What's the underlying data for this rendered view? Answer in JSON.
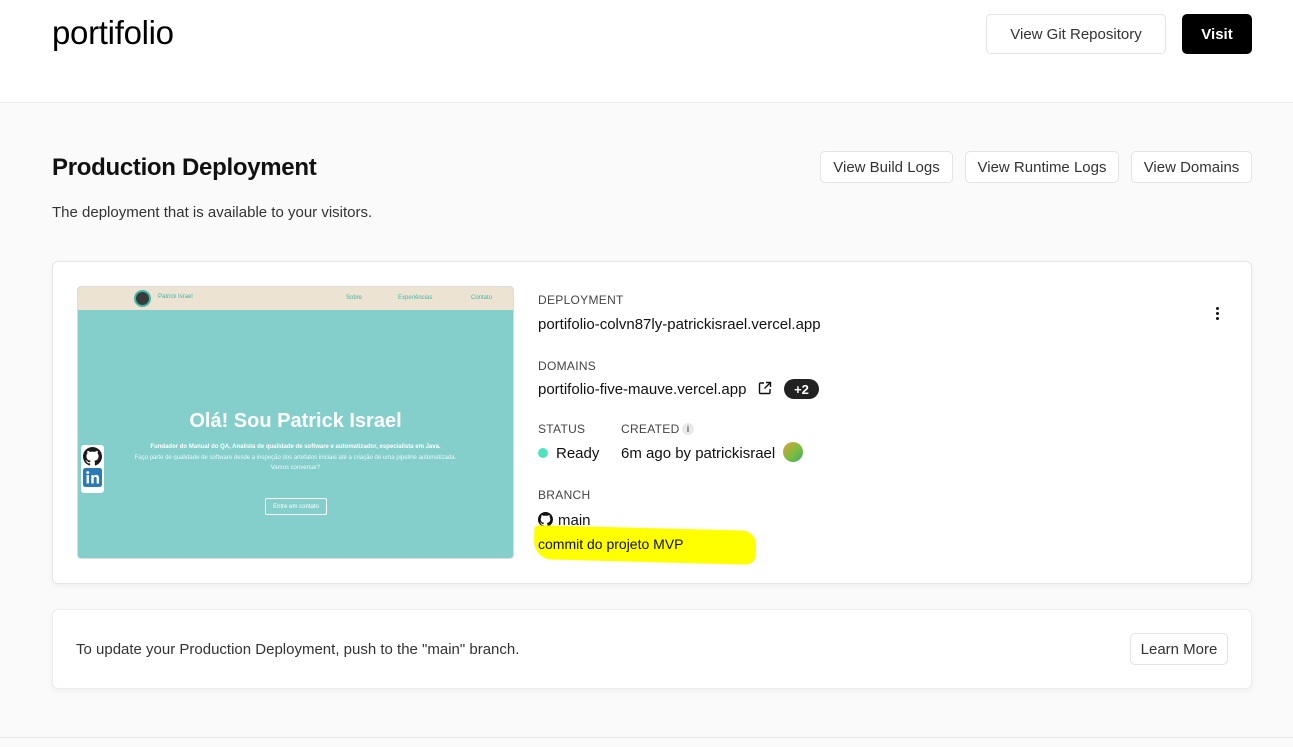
{
  "header": {
    "project_name": "portifolio",
    "git_button": "View Git Repository",
    "visit_button": "Visit"
  },
  "section": {
    "title": "Production Deployment",
    "subtitle": "The deployment that is available to your visitors.",
    "build_logs_button": "View Build Logs",
    "runtime_logs_button": "View Runtime Logs",
    "domains_button": "View Domains"
  },
  "preview": {
    "nav_name": "Patrick Israel",
    "nav_links": [
      "Sobre",
      "Experiências",
      "Contato"
    ],
    "headline": "Olá! Sou Patrick Israel",
    "line1": "Fundador do Manual do QA, Analista de qualidade de software e automatizador, especialista em Java.",
    "line2": "Faço parte de qualidade de software desde a inspeção dos artefatos iniciais até a criação de uma pipeline automatizada.",
    "line3": "Vamos conversar?",
    "cta": "Entre em contato",
    "social_icons": [
      "github-icon",
      "linkedin-icon"
    ]
  },
  "deployment": {
    "deployment_label": "DEPLOYMENT",
    "deployment_url": "portifolio-colvn87ly-patrickisrael.vercel.app",
    "domains_label": "DOMAINS",
    "domain": "portifolio-five-mauve.vercel.app",
    "domains_extra": "+2",
    "status_label": "STATUS",
    "status": "Ready",
    "status_color": "#50e3c2",
    "created_label": "CREATED",
    "created_info_icon": "i",
    "created": "6m ago by patrickisrael",
    "branch_label": "BRANCH",
    "branch": "main",
    "commit_message": "commit do projeto MVP",
    "highlight_color": "#ffff00"
  },
  "update": {
    "text": "To update your Production Deployment, push to the \"main\" branch.",
    "learn_more_button": "Learn More"
  }
}
